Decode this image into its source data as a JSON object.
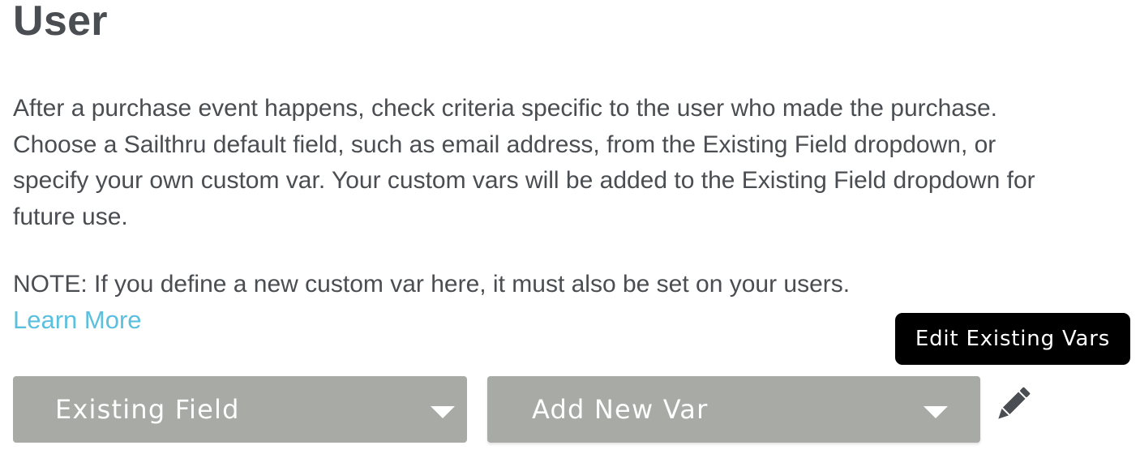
{
  "header": {
    "title": "User"
  },
  "content": {
    "description": "After a purchase event happens, check criteria specific to the user who made the purchase. Choose a Sailthru default field, such as email address, from the Existing Field dropdown, or specify your own custom var. Your custom vars will be added to the Existing Field dropdown for future use.",
    "note": "NOTE: If you define a new custom var here, it must also be set on your users.",
    "learn_more": "Learn More"
  },
  "tooltip": {
    "text": "Edit Existing Vars"
  },
  "controls": {
    "existing_field": {
      "value": "Existing Field"
    },
    "new_var": {
      "value": "Add New Var"
    },
    "edit_icon": "pencil-icon"
  },
  "colors": {
    "text": "#4a4d51",
    "link": "#5bc0de",
    "select_bg": "#a8aaa6",
    "tooltip_bg": "#000000"
  }
}
